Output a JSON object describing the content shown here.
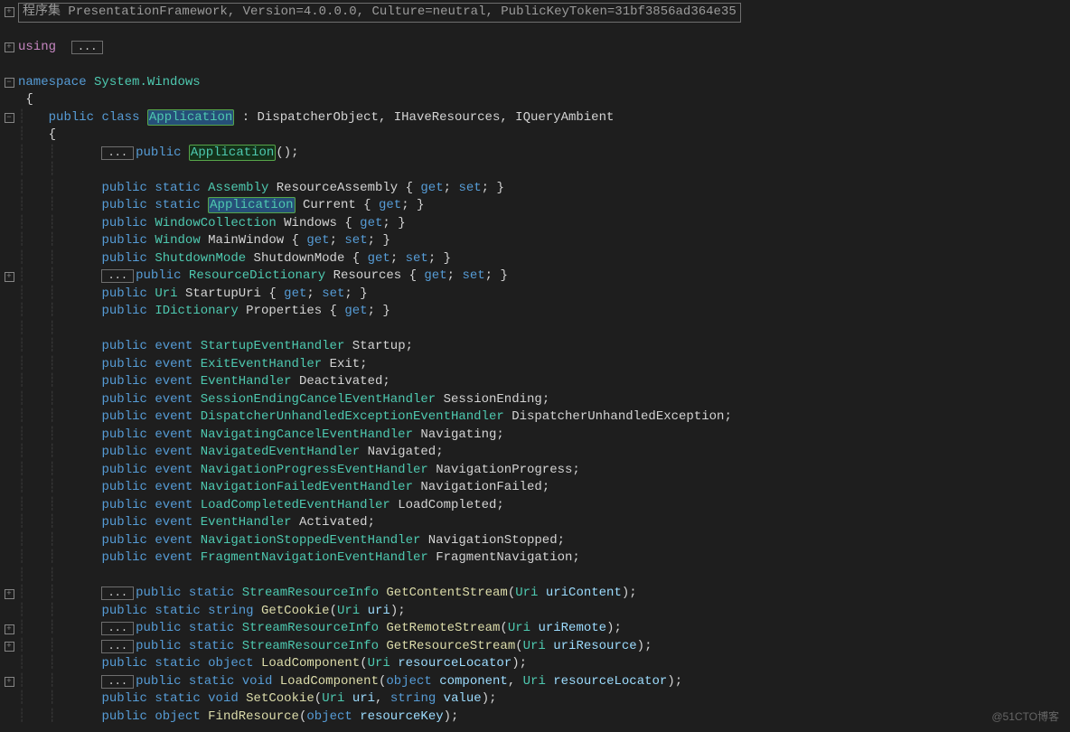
{
  "header": "程序集 PresentationFramework, Version=4.0.0.0, Culture=neutral, PublicKeyToken=31bf3856ad364e35",
  "usingKw": "using",
  "ellipsis": "...",
  "namespaceKw": "namespace",
  "namespaceName": "System.Windows",
  "openBrace": "{",
  "closeBrace": "}",
  "publicKw": "public",
  "classKw": "class",
  "staticKw": "static",
  "eventKw": "event",
  "voidKw": "void",
  "objectKw": "object",
  "stringKw": "string",
  "className": "Application",
  "baseList": " : DispatcherObject, IHaveResources, IQueryAmbient",
  "getKw": "get",
  "setKw": "set",
  "props": [
    {
      "type": "Assembly",
      "name": "ResourceAssembly",
      "static": true,
      "get": true,
      "set": true
    },
    {
      "type": "Application",
      "name": "Current",
      "static": true,
      "get": true,
      "set": false,
      "hl": true
    },
    {
      "type": "WindowCollection",
      "name": "Windows",
      "static": false,
      "get": true,
      "set": false
    },
    {
      "type": "Window",
      "name": "MainWindow",
      "static": false,
      "get": true,
      "set": true
    },
    {
      "type": "ShutdownMode",
      "name": "ShutdownMode",
      "static": false,
      "get": true,
      "set": true
    },
    {
      "type": "ResourceDictionary",
      "name": "Resources",
      "static": false,
      "get": true,
      "set": true,
      "box": true
    },
    {
      "type": "Uri",
      "name": "StartupUri",
      "static": false,
      "get": true,
      "set": true
    },
    {
      "type": "IDictionary",
      "name": "Properties",
      "static": false,
      "get": true,
      "set": false
    }
  ],
  "events": [
    {
      "type": "StartupEventHandler",
      "name": "Startup"
    },
    {
      "type": "ExitEventHandler",
      "name": "Exit"
    },
    {
      "type": "EventHandler",
      "name": "Deactivated"
    },
    {
      "type": "SessionEndingCancelEventHandler",
      "name": "SessionEnding"
    },
    {
      "type": "DispatcherUnhandledExceptionEventHandler",
      "name": "DispatcherUnhandledException"
    },
    {
      "type": "NavigatingCancelEventHandler",
      "name": "Navigating"
    },
    {
      "type": "NavigatedEventHandler",
      "name": "Navigated"
    },
    {
      "type": "NavigationProgressEventHandler",
      "name": "NavigationProgress"
    },
    {
      "type": "NavigationFailedEventHandler",
      "name": "NavigationFailed"
    },
    {
      "type": "LoadCompletedEventHandler",
      "name": "LoadCompleted"
    },
    {
      "type": "EventHandler",
      "name": "Activated"
    },
    {
      "type": "NavigationStoppedEventHandler",
      "name": "NavigationStopped"
    },
    {
      "type": "FragmentNavigationEventHandler",
      "name": "FragmentNavigation"
    }
  ],
  "methods": [
    {
      "box": true,
      "static": true,
      "ret": "StreamResourceInfo",
      "retKw": false,
      "name": "GetContentStream",
      "params": [
        {
          "t": "Uri",
          "n": "uriContent"
        }
      ]
    },
    {
      "box": false,
      "static": true,
      "ret": "string",
      "retKw": true,
      "name": "GetCookie",
      "params": [
        {
          "t": "Uri",
          "n": "uri"
        }
      ]
    },
    {
      "box": true,
      "static": true,
      "ret": "StreamResourceInfo",
      "retKw": false,
      "name": "GetRemoteStream",
      "params": [
        {
          "t": "Uri",
          "n": "uriRemote"
        }
      ]
    },
    {
      "box": true,
      "static": true,
      "ret": "StreamResourceInfo",
      "retKw": false,
      "name": "GetResourceStream",
      "params": [
        {
          "t": "Uri",
          "n": "uriResource"
        }
      ]
    },
    {
      "box": false,
      "static": true,
      "ret": "object",
      "retKw": true,
      "name": "LoadComponent",
      "params": [
        {
          "t": "Uri",
          "n": "resourceLocator"
        }
      ]
    },
    {
      "box": true,
      "static": true,
      "ret": "void",
      "retKw": true,
      "name": "LoadComponent",
      "params": [
        {
          "t": "object",
          "tk": true,
          "n": "component"
        },
        {
          "t": "Uri",
          "n": "resourceLocator"
        }
      ]
    },
    {
      "box": false,
      "static": true,
      "ret": "void",
      "retKw": true,
      "name": "SetCookie",
      "params": [
        {
          "t": "Uri",
          "n": "uri"
        },
        {
          "t": "string",
          "tk": true,
          "n": "value"
        }
      ]
    },
    {
      "box": false,
      "static": false,
      "ret": "object",
      "retKw": true,
      "name": "FindResource",
      "params": [
        {
          "t": "object",
          "tk": true,
          "n": "resourceKey"
        }
      ]
    }
  ],
  "watermark": "@51CTO博客"
}
